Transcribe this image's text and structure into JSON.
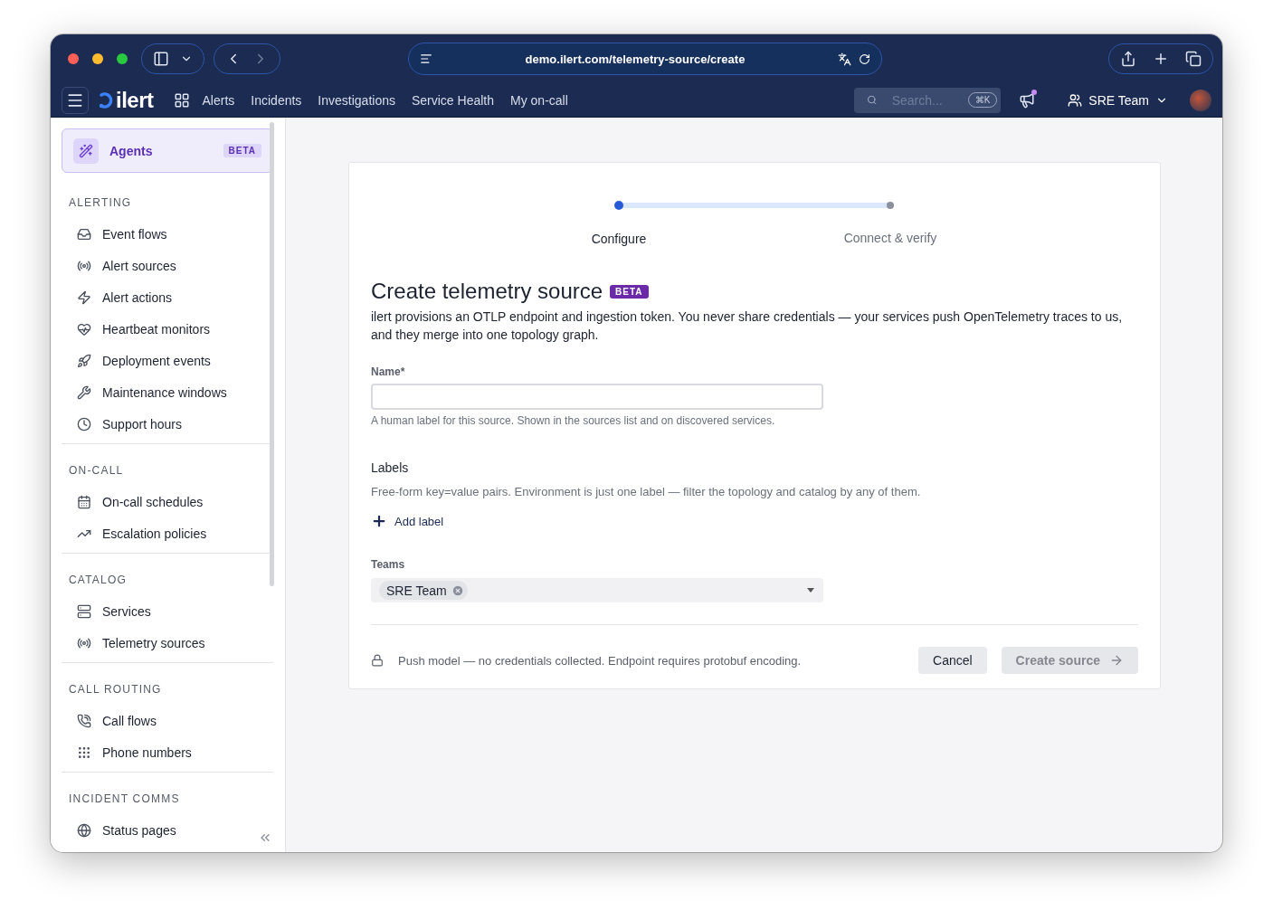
{
  "browser": {
    "url": "demo.ilert.com/telemetry-source/create"
  },
  "app_nav": {
    "logo": "ilert",
    "items": [
      {
        "label": "Alerts"
      },
      {
        "label": "Incidents"
      },
      {
        "label": "Investigations"
      },
      {
        "label": "Service Health"
      },
      {
        "label": "My on-call"
      }
    ],
    "search": {
      "placeholder": "Search...",
      "shortcut": "⌘K"
    },
    "team": "SRE Team"
  },
  "sidebar": {
    "agents": {
      "label": "Agents",
      "badge": "BETA"
    },
    "sections": [
      {
        "title": "ALERTING",
        "items": [
          {
            "label": "Event flows"
          },
          {
            "label": "Alert sources"
          },
          {
            "label": "Alert actions"
          },
          {
            "label": "Heartbeat monitors"
          },
          {
            "label": "Deployment events"
          },
          {
            "label": "Maintenance windows"
          },
          {
            "label": "Support hours"
          }
        ]
      },
      {
        "title": "ON-CALL",
        "items": [
          {
            "label": "On-call schedules"
          },
          {
            "label": "Escalation policies"
          }
        ]
      },
      {
        "title": "CATALOG",
        "items": [
          {
            "label": "Services"
          },
          {
            "label": "Telemetry sources"
          }
        ]
      },
      {
        "title": "CALL ROUTING",
        "items": [
          {
            "label": "Call flows"
          },
          {
            "label": "Phone numbers"
          }
        ]
      },
      {
        "title": "INCIDENT COMMS",
        "items": [
          {
            "label": "Status pages"
          }
        ]
      }
    ]
  },
  "stepper": {
    "steps": [
      {
        "label": "Configure",
        "selected": true
      },
      {
        "label": "Connect & verify",
        "selected": false
      }
    ]
  },
  "form": {
    "title": "Create telemetry source",
    "badge": "BETA",
    "description": "ilert provisions an OTLP endpoint and ingestion token. You never share credentials — your services push OpenTelemetry traces to us, and they merge into one topology graph.",
    "name_field": {
      "label": "Name",
      "required_mark": "*",
      "hint": "A human label for this source. Shown in the sources list and on discovered services."
    },
    "labels": {
      "heading": "Labels",
      "description": "Free-form key=value pairs. Environment is just one label — filter the topology and catalog by any of them.",
      "add_button": "Add label"
    },
    "teams": {
      "label": "Teams",
      "chips": [
        {
          "label": "SRE Team"
        }
      ]
    },
    "footer": {
      "note": "Push model — no credentials collected. Endpoint requires protobuf encoding.",
      "buttons": [
        {
          "label": "Cancel",
          "kind": "secondary",
          "disabled": false
        },
        {
          "label": "Create source",
          "kind": "primary",
          "disabled": true
        }
      ]
    }
  }
}
